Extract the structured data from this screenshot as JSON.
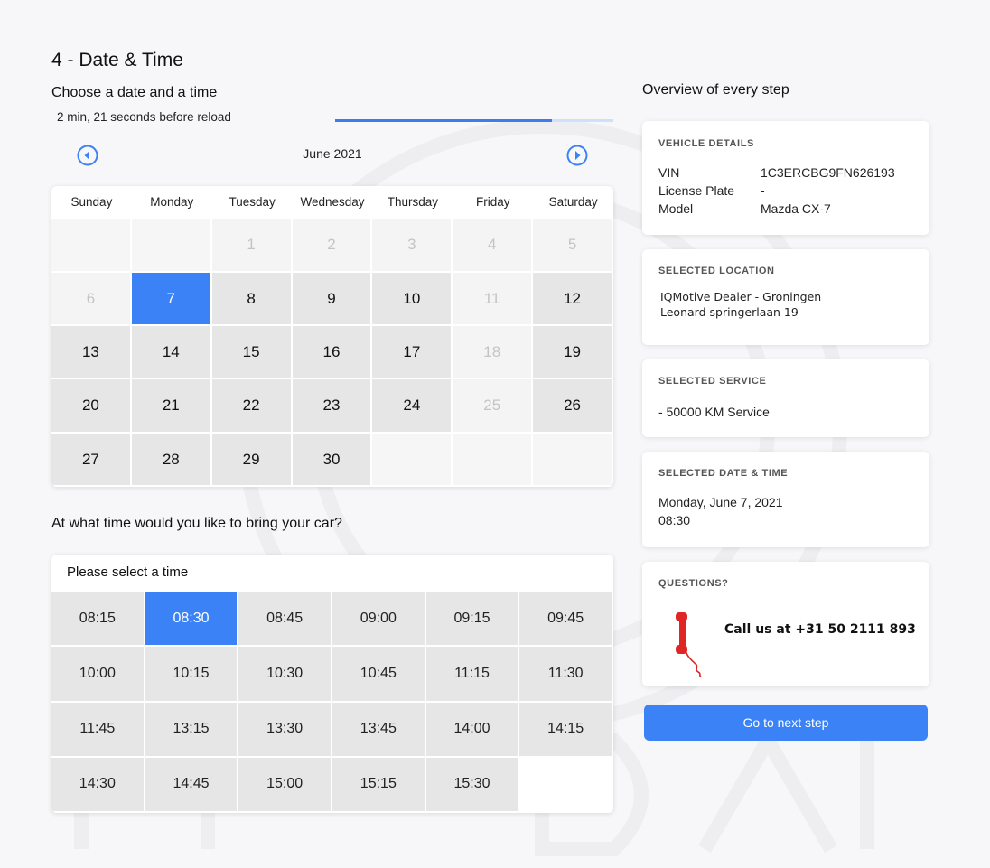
{
  "page": {
    "title": "4 - Date & Time",
    "subtitle": "Choose a date and a time",
    "reload_text": "2 min, 21 seconds before reload",
    "reload_progress": 0.78
  },
  "calendar": {
    "month_label": "June 2021",
    "weekdays": [
      "Sunday",
      "Monday",
      "Tuesday",
      "Wednesday",
      "Thursday",
      "Friday",
      "Saturday"
    ],
    "cells": [
      {
        "label": "",
        "state": "empty"
      },
      {
        "label": "",
        "state": "empty"
      },
      {
        "label": "1",
        "state": "unavailable"
      },
      {
        "label": "2",
        "state": "unavailable"
      },
      {
        "label": "3",
        "state": "unavailable"
      },
      {
        "label": "4",
        "state": "unavailable"
      },
      {
        "label": "5",
        "state": "unavailable"
      },
      {
        "label": "6",
        "state": "unavailable"
      },
      {
        "label": "7",
        "state": "selected"
      },
      {
        "label": "8",
        "state": "available"
      },
      {
        "label": "9",
        "state": "available"
      },
      {
        "label": "10",
        "state": "available"
      },
      {
        "label": "11",
        "state": "unavailable"
      },
      {
        "label": "12",
        "state": "available"
      },
      {
        "label": "13",
        "state": "available"
      },
      {
        "label": "14",
        "state": "available"
      },
      {
        "label": "15",
        "state": "available"
      },
      {
        "label": "16",
        "state": "available"
      },
      {
        "label": "17",
        "state": "available"
      },
      {
        "label": "18",
        "state": "unavailable"
      },
      {
        "label": "19",
        "state": "available"
      },
      {
        "label": "20",
        "state": "available"
      },
      {
        "label": "21",
        "state": "available"
      },
      {
        "label": "22",
        "state": "available"
      },
      {
        "label": "23",
        "state": "available"
      },
      {
        "label": "24",
        "state": "available"
      },
      {
        "label": "25",
        "state": "unavailable"
      },
      {
        "label": "26",
        "state": "available"
      },
      {
        "label": "27",
        "state": "available"
      },
      {
        "label": "28",
        "state": "available"
      },
      {
        "label": "29",
        "state": "available"
      },
      {
        "label": "30",
        "state": "available"
      },
      {
        "label": "",
        "state": "empty"
      },
      {
        "label": "",
        "state": "empty"
      },
      {
        "label": "",
        "state": "empty"
      }
    ]
  },
  "time": {
    "question": "At what time would you like to bring your car?",
    "header": "Please select a time",
    "selected": "08:30",
    "slots": [
      "08:15",
      "08:30",
      "08:45",
      "09:00",
      "09:15",
      "09:45",
      "10:00",
      "10:15",
      "10:30",
      "10:45",
      "11:15",
      "11:30",
      "11:45",
      "13:15",
      "13:30",
      "13:45",
      "14:00",
      "14:15",
      "14:30",
      "14:45",
      "15:00",
      "15:15",
      "15:30"
    ]
  },
  "overview": {
    "title": "Overview of every step",
    "vehicle": {
      "heading": "VEHICLE DETAILS",
      "vin_label": "VIN",
      "vin": "1C3ERCBG9FN626193",
      "plate_label": "License Plate",
      "plate": "-",
      "model_label": "Model",
      "model": "Mazda CX-7"
    },
    "location": {
      "heading": "SELECTED LOCATION",
      "name": "IQMotive Dealer - Groningen",
      "address": "Leonard springerlaan 19"
    },
    "service": {
      "heading": "SELECTED SERVICE",
      "text": "- 50000 KM Service"
    },
    "datetime": {
      "heading": "SELECTED DATE & TIME",
      "date": "Monday, June 7, 2021",
      "time": "08:30"
    },
    "questions": {
      "heading": "QUESTIONS?",
      "call_text": "Call us at +31 50 2111 893"
    }
  },
  "next_button": "Go to next step",
  "colors": {
    "accent": "#3b82f6",
    "phone_red": "#e02525",
    "available_cell": "#e6e6e6"
  },
  "icons": {
    "prev_month": "chevron-left-circle-icon",
    "next_month": "chevron-right-circle-icon",
    "phone": "phone-handset-icon"
  }
}
